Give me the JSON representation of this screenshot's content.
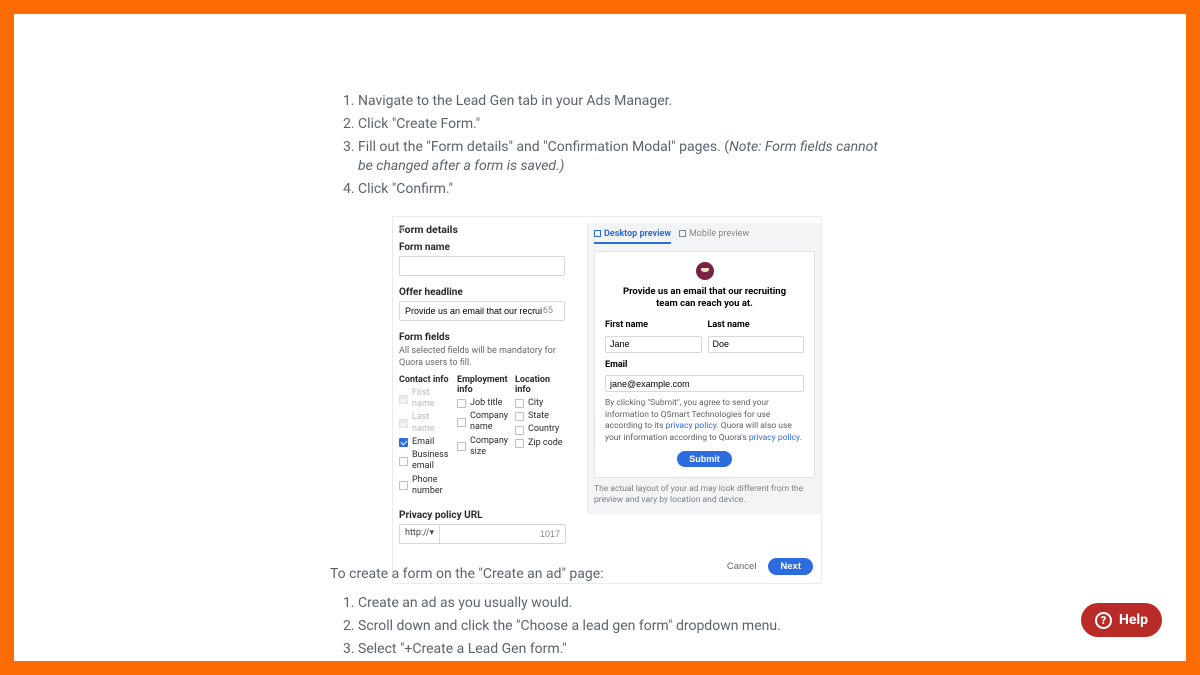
{
  "instructions": {
    "list1": [
      "Navigate to the Lead Gen tab in your Ads Manager.",
      "Click \"Create Form.\"",
      "Fill out the \"Form details\" and \"Confirmation Modal\" pages. (",
      "Click \"Confirm.\""
    ],
    "note3": "Note: Form fields cannot be changed after a form is saved.)"
  },
  "builder": {
    "title": "Form details",
    "form_name_label": "Form name",
    "offer_headline_label": "Offer headline",
    "offer_headline_value": "Provide us an email that our recruiting",
    "offer_headline_count": "65",
    "form_fields_label": "Form fields",
    "form_fields_note": "All selected fields will be mandatory for Quora users to fill.",
    "col1_hd": "Contact info",
    "col1_items": [
      "First name",
      "Last name",
      "Email",
      "Business email",
      "Phone number"
    ],
    "col2_hd": "Employment info",
    "col2_items": [
      "Job title",
      "Company name",
      "Company size"
    ],
    "col3_hd": "Location info",
    "col3_items": [
      "City",
      "State",
      "Country",
      "Zip code"
    ],
    "privacy_label": "Privacy policy URL",
    "url_scheme": "http://▾",
    "url_count": "1017"
  },
  "preview": {
    "tab_desktop": "Desktop preview",
    "tab_mobile": "Mobile preview",
    "headline": "Provide us an email that our recruiting team can reach you at.",
    "first_name_label": "First name",
    "first_name_value": "Jane",
    "last_name_label": "Last name",
    "last_name_value": "Doe",
    "email_label": "Email",
    "email_value": "jane@example.com",
    "consent_pre": "By clicking \"Submit\", you agree to send your information to QSmart Technologies for use according to its ",
    "privacy_policy_link": "privacy policy",
    "consent_mid": ". Quora will also use your information according to Quora's ",
    "submit_label": "Submit",
    "note": "The actual layout of your ad may look different from the preview and vary by location and device."
  },
  "footer": {
    "cancel": "Cancel",
    "next": "Next"
  },
  "section2_intro": "To create a form on the \"Create an ad\" page:",
  "section2_steps": [
    "Create an ad as you usually would.",
    "Scroll down and click the \"Choose a lead gen form\" dropdown menu.",
    "Select \"+Create a Lead Gen form.\""
  ],
  "help_label": "Help"
}
